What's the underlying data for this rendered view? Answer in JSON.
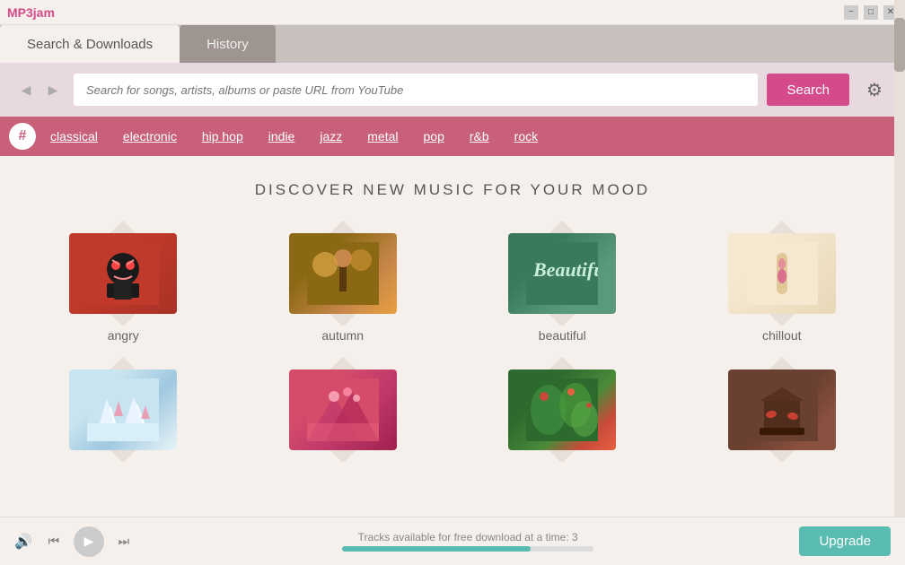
{
  "app": {
    "logo": "MP3jam"
  },
  "titlebar": {
    "minimize": "−",
    "maximize": "□",
    "close": "✕"
  },
  "tabs": [
    {
      "id": "search",
      "label": "Search & Downloads",
      "active": true
    },
    {
      "id": "history",
      "label": "History",
      "active": false
    }
  ],
  "search": {
    "placeholder": "Search for songs, artists, albums or paste URL from YouTube",
    "button_label": "Search"
  },
  "genres": {
    "hash": "#",
    "items": [
      {
        "label": "classical"
      },
      {
        "label": "electronic"
      },
      {
        "label": "hip hop"
      },
      {
        "label": "indie"
      },
      {
        "label": "jazz"
      },
      {
        "label": "metal"
      },
      {
        "label": "pop"
      },
      {
        "label": "r&b"
      },
      {
        "label": "rock"
      }
    ]
  },
  "discover": {
    "title": "DISCOVER NEW MUSIC FOR YOUR MOOD",
    "moods": [
      {
        "id": "angry",
        "label": "angry",
        "color_class": "angry-img"
      },
      {
        "id": "autumn",
        "label": "autumn",
        "color_class": "autumn-img"
      },
      {
        "id": "beautiful",
        "label": "beautiful",
        "color_class": "beautiful-img"
      },
      {
        "id": "chillout",
        "label": "chillout",
        "color_class": "chillout-img"
      },
      {
        "id": "winter",
        "label": "",
        "color_class": "winter-img"
      },
      {
        "id": "nature",
        "label": "",
        "color_class": "nature-img"
      },
      {
        "id": "green",
        "label": "",
        "color_class": "green-img"
      },
      {
        "id": "relax",
        "label": "",
        "color_class": "relax-img"
      }
    ]
  },
  "player": {
    "volume_icon": "🔊",
    "prev_icon": "⏮",
    "play_icon": "▶",
    "next_icon": "⏭",
    "tracks_status": "Tracks available for free download at a time:",
    "tracks_count": "3",
    "progress_percent": 75,
    "upgrade_label": "Upgrade"
  }
}
